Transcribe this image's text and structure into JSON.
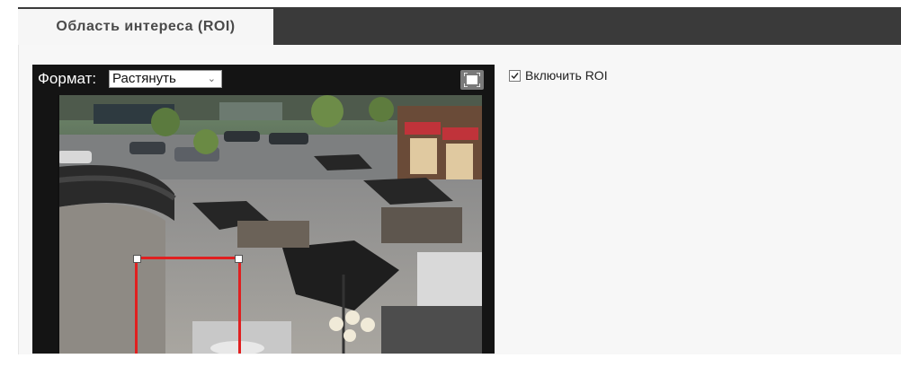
{
  "tab": {
    "label": "Область интереса (ROI)"
  },
  "viewer": {
    "format_label": "Формат:",
    "format_value": "Растянуть",
    "fullscreen_icon": "fullscreen-icon"
  },
  "roi": {
    "enable_label": "Включить ROI",
    "enabled": true
  },
  "colors": {
    "tabbar_bg": "#3a3a3a",
    "roi_border": "#e02020",
    "viewer_bg": "#141414"
  }
}
